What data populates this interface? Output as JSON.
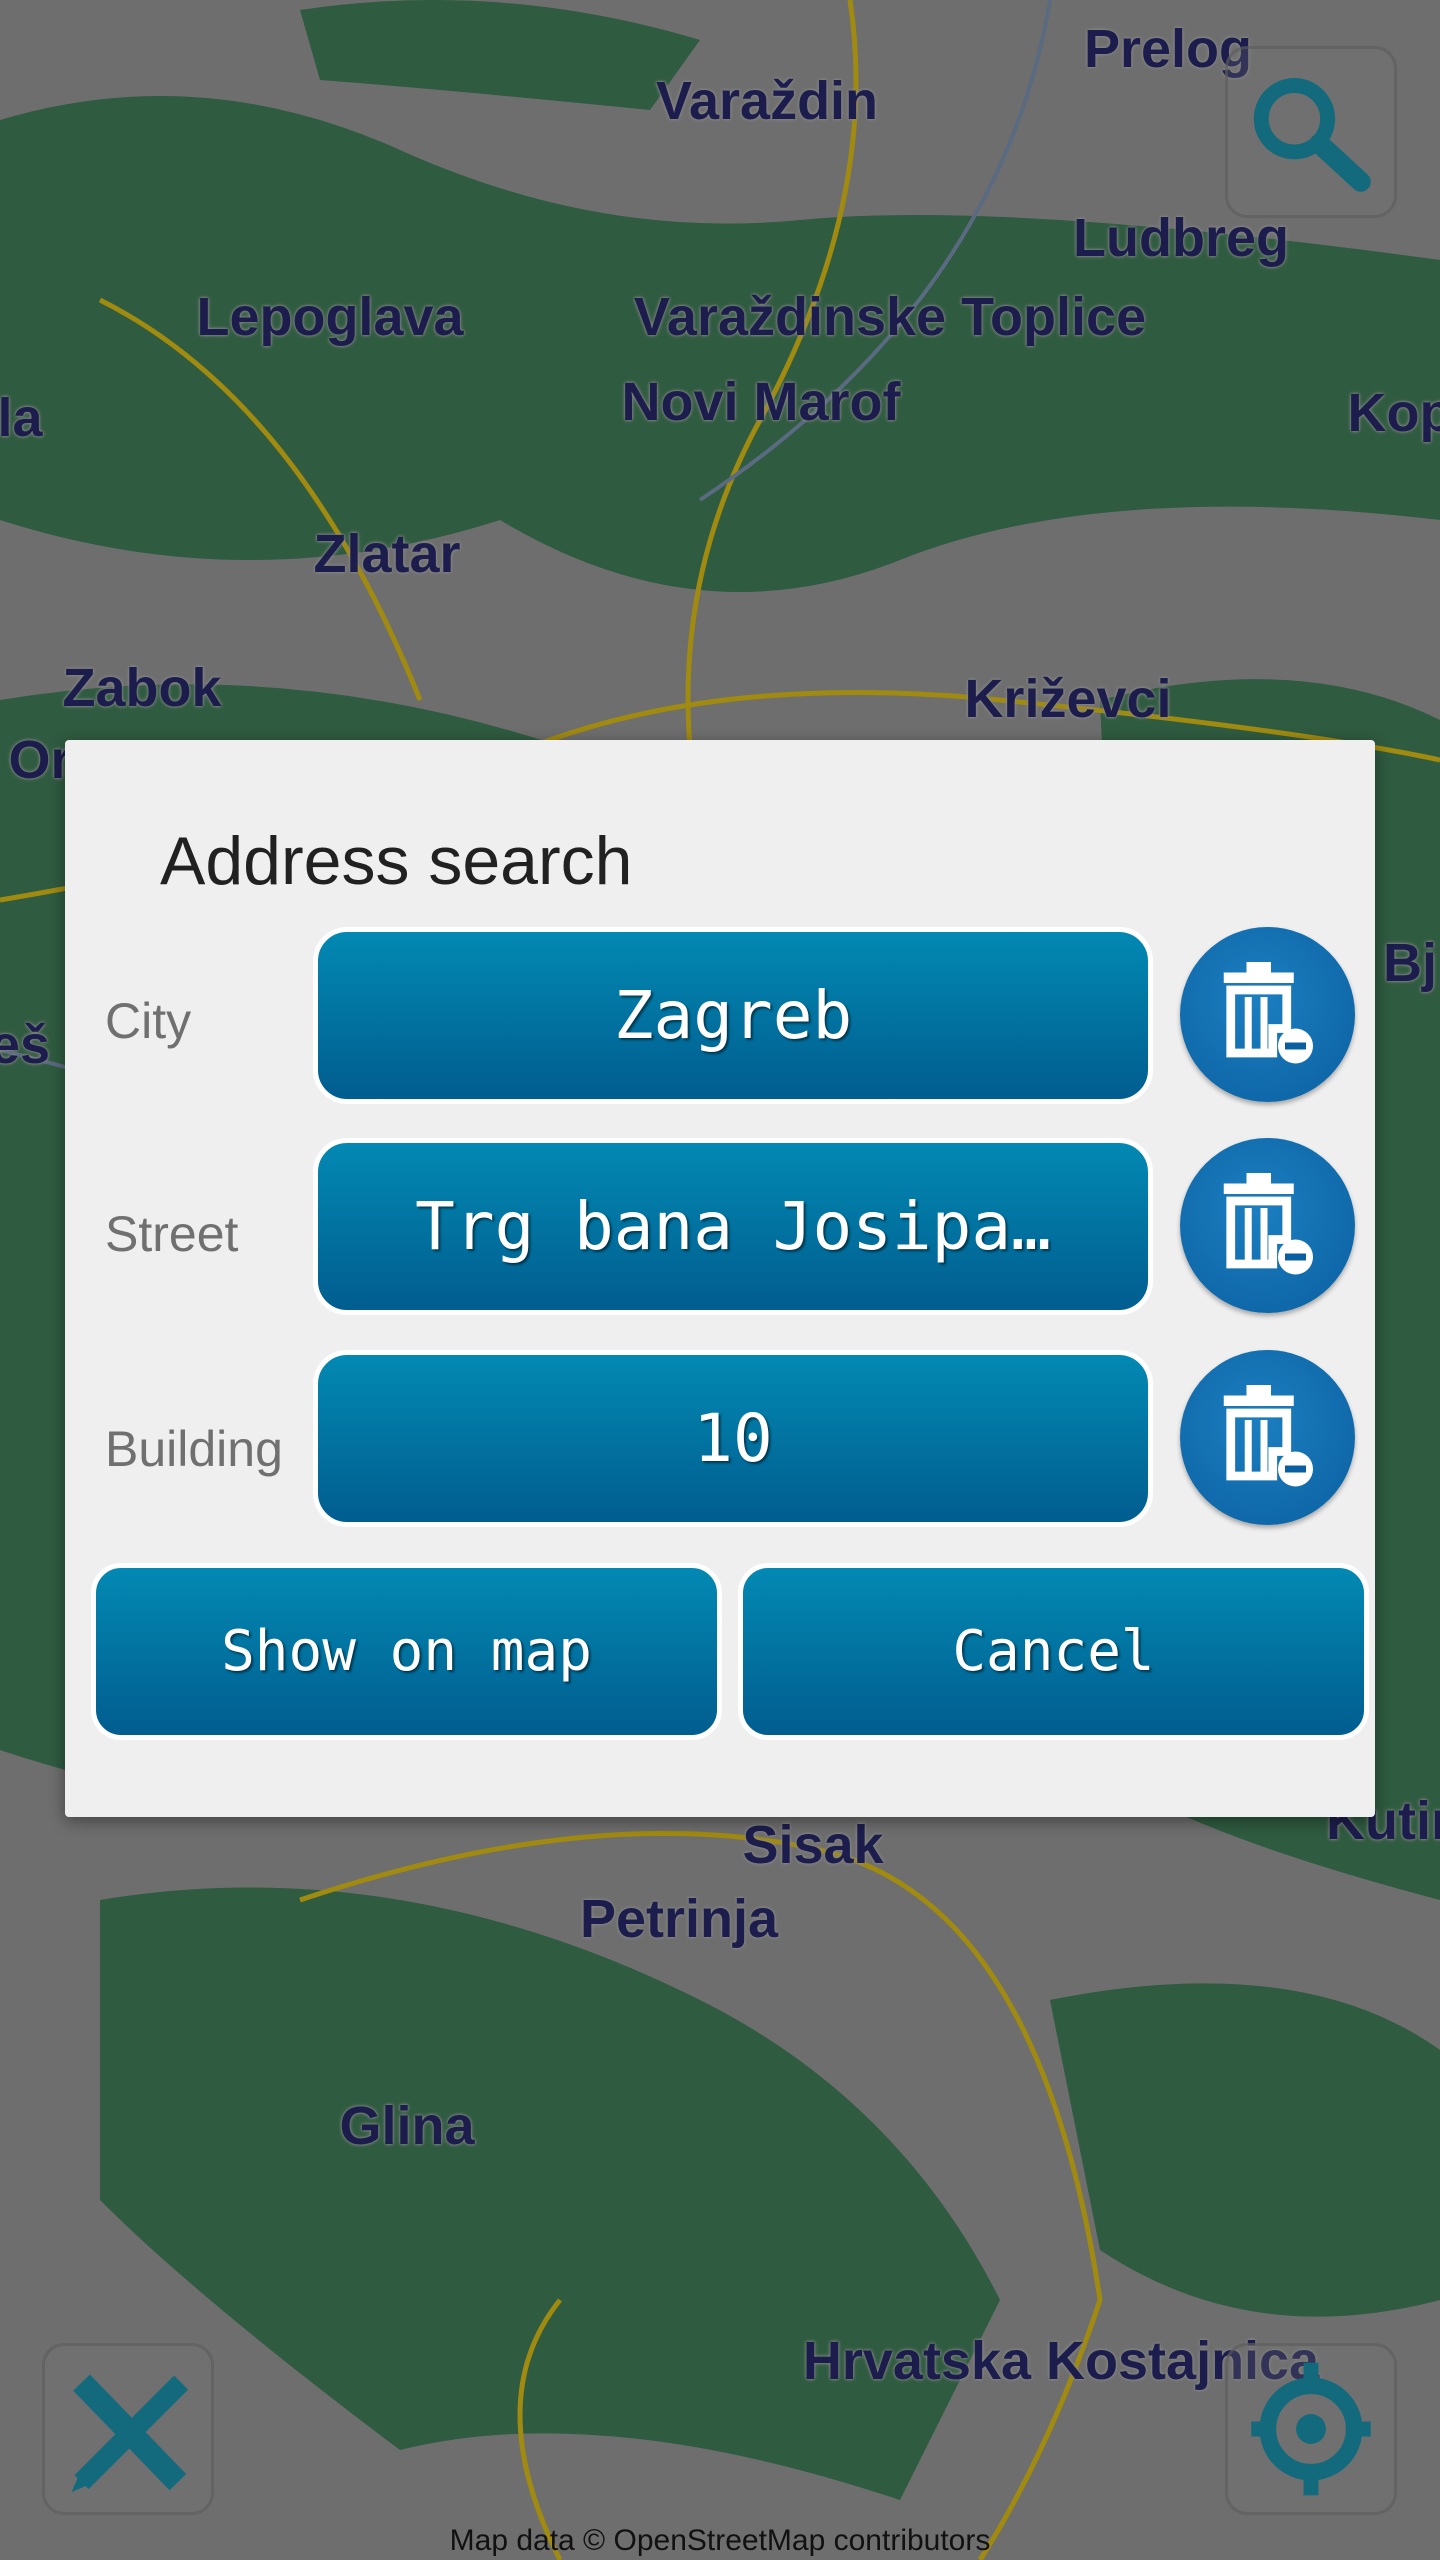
{
  "map": {
    "places": [
      {
        "name": "Prelog"
      },
      {
        "name": "Varaždin"
      },
      {
        "name": "Ludbreg"
      },
      {
        "name": "Lepoglava"
      },
      {
        "name": "Varaždinske Toplice"
      },
      {
        "name": "Novi Marof"
      },
      {
        "name": "Kop"
      },
      {
        "name": "la"
      },
      {
        "name": "Zlatar"
      },
      {
        "name": "Zabok"
      },
      {
        "name": "Križevci"
      },
      {
        "name": "Or"
      },
      {
        "name": "Bj"
      },
      {
        "name": "eš"
      },
      {
        "name": "Sisak"
      },
      {
        "name": "Kutin"
      },
      {
        "name": "Petrinja"
      },
      {
        "name": "Glina"
      },
      {
        "name": "Hrvatska Kostajnica"
      }
    ],
    "attribution": "Map data © OpenStreetMap contributors",
    "colors": {
      "forest": "#2f5b40",
      "land": "#6e6e6e",
      "road": "#a08a10",
      "label": "#1d1d4d"
    }
  },
  "controls": {
    "search_icon": "magnifier-icon",
    "tools_icon": "ruler-pencil-icon",
    "locate_icon": "crosshair-icon"
  },
  "dialog": {
    "title": "Address search",
    "fields": [
      {
        "label": "City",
        "value": "Zagreb"
      },
      {
        "label": "Street",
        "value": "Trg bana Josipa…"
      },
      {
        "label": "Building",
        "value": "10"
      }
    ],
    "clear_icon": "trash-minus-icon",
    "show_on_map": "Show on map",
    "cancel": "Cancel",
    "accent": "#0277a6"
  }
}
